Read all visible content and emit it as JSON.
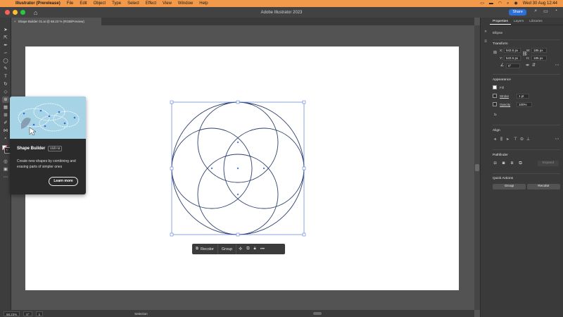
{
  "menubar": {
    "app_name": "Illustrator (Prerelease)",
    "items": [
      "File",
      "Edit",
      "Object",
      "Type",
      "Select",
      "Effect",
      "View",
      "Window",
      "Help"
    ],
    "datetime": "Wed 30 Aug  12:44"
  },
  "appbar": {
    "title": "Adobe Illustrator 2023",
    "share_label": "Share"
  },
  "document_tab": {
    "name": "Shape Builder 01.ai @ 68.23 % (RGB/Preview)"
  },
  "context_toolbar": {
    "recolor_label": "Recolor",
    "group_label": "Group",
    "more_label": "•••"
  },
  "status_bar": {
    "zoom": "68.23%",
    "rotation": "0°",
    "artboard": "1",
    "tool": "Selection"
  },
  "tooltip": {
    "title": "Shape Builder",
    "shortcut": "Shift+M",
    "description": "Create new shapes by combining and erasing parts of simpler ones",
    "learn_more": "Learn more"
  },
  "panel": {
    "tabs": [
      "Properties",
      "Layers",
      "Libraries"
    ],
    "object_type": "Ellipse",
    "transform_label": "Transform",
    "x_label": "X:",
    "x_value": "543.5 px",
    "y_label": "Y:",
    "y_value": "543.5 px",
    "w_label": "W:",
    "w_value": "185 px",
    "h_label": "H:",
    "h_value": "185 px",
    "angle_value": "0°",
    "appearance_label": "Appearance",
    "fill_label": "Fill",
    "stroke_label": "Stroke",
    "stroke_value": "1 pt",
    "opacity_label": "Opacity",
    "opacity_value": "100%",
    "fx_label": "fx.",
    "align_label": "Align",
    "pathfinder_label": "Pathfinder",
    "expand_label": "Expand",
    "quick_actions_label": "Quick Actions",
    "group_button": "Group",
    "recolor_button": "Recolor"
  },
  "colors": {
    "menubar": "#f29a4a",
    "chrome": "#424242",
    "canvas_bg": "#535353",
    "artboard": "#ffffff",
    "shape_stroke": "#2e3f6e",
    "selection": "#5b7fd6",
    "share_button": "#2d6fd6",
    "tooltip_art_bg": "#a6d4e6"
  }
}
